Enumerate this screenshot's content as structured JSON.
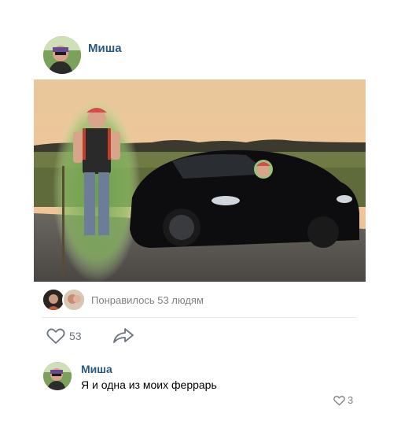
{
  "post": {
    "author": "Миша"
  },
  "likes": {
    "summary": "Понравилось 53 людям",
    "count": "53"
  },
  "comment": {
    "author": "Миша",
    "text": "Я и одна из моих феррарь",
    "likes": "3"
  },
  "icons": {
    "like": "heart-icon",
    "share": "share-arrow-icon"
  },
  "colors": {
    "link": "#2a5885",
    "muted": "#828282",
    "divider": "#e7e8ec"
  }
}
